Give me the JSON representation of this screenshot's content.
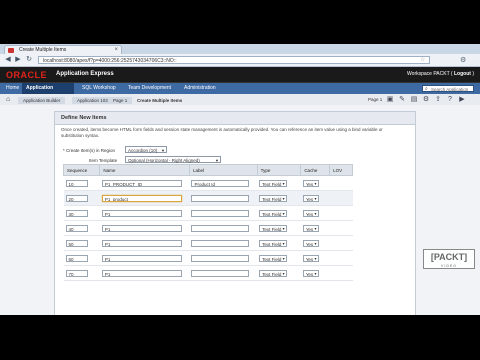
{
  "browser": {
    "tab_title": "Create Multiple Items",
    "url": "localhost:8080/apex/f?p=4000:256:2525743034706C3::NO::"
  },
  "header": {
    "logo": "ORACLE",
    "app_name": "Application Express",
    "workspace": "Workspace PACKT",
    "logout": "Logout"
  },
  "nav": {
    "items": [
      "Home",
      "Application Builder",
      "SQL Workshop",
      "Team Development",
      "Administration"
    ],
    "search_placeholder": "Search Application"
  },
  "breadcrumb": {
    "items": [
      "Application Builder",
      "Application 103",
      "Page 1",
      "Create Multiple Items"
    ],
    "page_label": "Page 1"
  },
  "panel": {
    "title": "Define New Items",
    "description": "Once created, items become HTML form fields and session state management is automatically provided. You can reference an item value using a bind variable or substitution syntax.",
    "region_label": "Create Item(s) in Region",
    "region_value": "Accordion (10)",
    "template_label": "Item Template",
    "template_value": "Optional (Horizontal - Right Aligned)",
    "columns": [
      "Sequence",
      "Name",
      "Label",
      "Type",
      "Cache",
      "LOV"
    ],
    "rows": [
      {
        "seq": "10",
        "name": "P1_PRODUCT_ID",
        "label": "Product Id",
        "type": "Text Field",
        "cache": "Yes"
      },
      {
        "seq": "20",
        "name": "P1_product",
        "label": "",
        "type": "Text Field",
        "cache": "Yes"
      },
      {
        "seq": "30",
        "name": "P1_",
        "label": "",
        "type": "Text Field",
        "cache": "Yes"
      },
      {
        "seq": "40",
        "name": "P1_",
        "label": "",
        "type": "Text Field",
        "cache": "Yes"
      },
      {
        "seq": "50",
        "name": "P1_",
        "label": "",
        "type": "Text Field",
        "cache": "Yes"
      },
      {
        "seq": "60",
        "name": "P1_",
        "label": "",
        "type": "Text Field",
        "cache": "Yes"
      },
      {
        "seq": "70",
        "name": "P1_",
        "label": "",
        "type": "Text Field",
        "cache": "Yes"
      }
    ]
  },
  "watermark": {
    "text": "[PACKT]",
    "sub": "VIDEO"
  },
  "colors": {
    "nav": "#3e6aa3",
    "nav_active": "#1c3f6e",
    "oracle_red": "#e2231a"
  }
}
